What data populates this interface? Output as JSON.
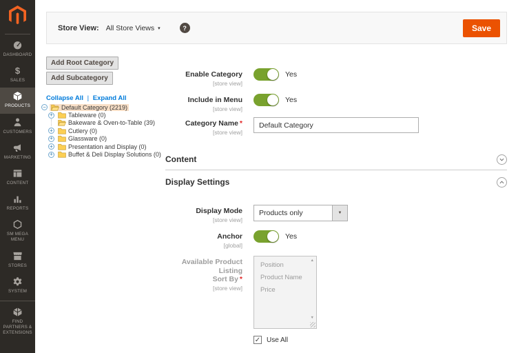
{
  "colors": {
    "accent_orange": "#eb5202",
    "logo_orange": "#f26322",
    "toggle_green": "#79a22e",
    "link_blue": "#007bdb",
    "sidebar_bg": "#2d2a26",
    "sidebar_selected_bg": "#4e4943",
    "tree_selected_bg": "#f8dfc7",
    "toolbar_bg": "#f8f8f8"
  },
  "icons": {
    "help": "?",
    "caret_down": "▾",
    "select_arrow": "▼",
    "scroll_up": "▲",
    "scroll_down": "▼",
    "check": "✓",
    "expander_plus": "+",
    "expander_minus": "−",
    "link_separator": "|"
  },
  "toolbar": {
    "store_view_label": "Store View:",
    "store_view_value": "All Store Views",
    "save_label": "Save"
  },
  "sidebar": {
    "items": [
      {
        "label": "DASHBOARD"
      },
      {
        "label": "SALES"
      },
      {
        "label": "PRODUCTS",
        "selected": true
      },
      {
        "label": "CUSTOMERS"
      },
      {
        "label": "MARKETING"
      },
      {
        "label": "CONTENT"
      },
      {
        "label": "REPORTS"
      },
      {
        "label": "SM MEGA MENU"
      },
      {
        "label": "STORES"
      },
      {
        "label": "SYSTEM"
      },
      {
        "label": "FIND PARTNERS & EXTENSIONS"
      }
    ]
  },
  "category_tree": {
    "add_root_button": "Add Root Category",
    "add_subcategory_button": "Add Subcategory",
    "collapse_all": "Collapse All",
    "expand_all": "Expand All",
    "nodes": [
      {
        "label": "Default Category (2219)",
        "selected": true,
        "expander": "minus",
        "folder": "open"
      },
      {
        "label": "Tableware (0)",
        "expander": "plus",
        "folder": "closed"
      },
      {
        "label": "Bakeware & Oven-to-Table (39)",
        "expander": "none",
        "folder": "open"
      },
      {
        "label": "Cutlery (0)",
        "expander": "plus",
        "folder": "closed"
      },
      {
        "label": "Glassware (0)",
        "expander": "plus",
        "folder": "closed"
      },
      {
        "label": "Presentation and Display (0)",
        "expander": "plus",
        "folder": "closed"
      },
      {
        "label": "Buffet & Deli Display Solutions (0)",
        "expander": "plus",
        "folder": "closed"
      }
    ]
  },
  "form": {
    "enable_category": {
      "label": "Enable Category",
      "scope": "[store view]",
      "value": "Yes",
      "state": "on"
    },
    "include_in_menu": {
      "label": "Include in Menu",
      "scope": "[store view]",
      "value": "Yes",
      "state": "on"
    },
    "category_name": {
      "label": "Category Name",
      "scope": "[store view]",
      "required": "*",
      "value": "Default Category"
    },
    "sections": {
      "content": "Content",
      "display_settings": "Display Settings"
    },
    "display_mode": {
      "label": "Display Mode",
      "scope": "[store view]",
      "value": "Products only"
    },
    "anchor": {
      "label": "Anchor",
      "scope": "[global]",
      "value": "Yes",
      "state": "on"
    },
    "sort_by": {
      "label_line1": "Available Product Listing",
      "label_line2": "Sort By",
      "required": "*",
      "scope": "[store view]",
      "options": [
        "Position",
        "Product Name",
        "Price"
      ],
      "disabled": true
    },
    "use_all": {
      "label": "Use All",
      "checked": true
    }
  }
}
